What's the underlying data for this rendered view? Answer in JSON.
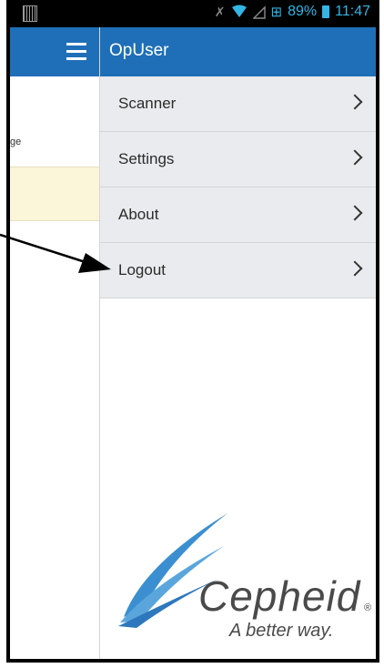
{
  "status_bar": {
    "battery_percent": "89%",
    "time": "11:47",
    "icons": [
      "barcode-icon",
      "mute-icon",
      "wifi-icon",
      "signal-icon",
      "network-icon",
      "battery-icon"
    ]
  },
  "underlying_screen": {
    "visible_text_fragment": "ge"
  },
  "drawer": {
    "title": "OpUser",
    "items": [
      {
        "label": "Scanner"
      },
      {
        "label": "Settings"
      },
      {
        "label": "About"
      },
      {
        "label": "Logout"
      }
    ]
  },
  "logo": {
    "brand": "Cepheid",
    "registered_mark": "®",
    "tagline": "A better way."
  },
  "annotation": {
    "arrow_points_to": "Logout"
  },
  "colors": {
    "appbar_blue": "#1f6fb8",
    "menu_bg": "#e9ebee",
    "status_accent": "#33b5e5",
    "logo_blue": "#3b8fd0"
  }
}
